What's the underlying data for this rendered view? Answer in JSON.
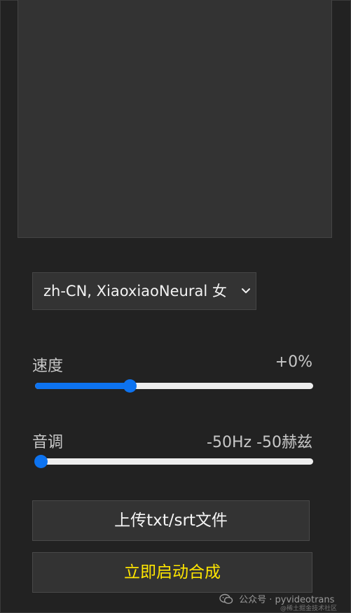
{
  "voice_select": {
    "selected": "zh-CN, XiaoxiaoNeural 女"
  },
  "speed": {
    "label": "速度",
    "value_text": "+0%",
    "fraction": 0.34
  },
  "pitch": {
    "label": "音调",
    "value_text": "-50Hz -50赫兹",
    "fraction": 0.02
  },
  "buttons": {
    "upload_label": "上传txt/srt文件",
    "start_label": "立即启动合成"
  },
  "watermark": {
    "text": "公众号 · pyvideotrans",
    "sub": "@稀土掘金技术社区"
  },
  "colors": {
    "accent": "#0d73f0",
    "start_text": "#ffe600",
    "background": "#222222",
    "panel": "#333333"
  }
}
